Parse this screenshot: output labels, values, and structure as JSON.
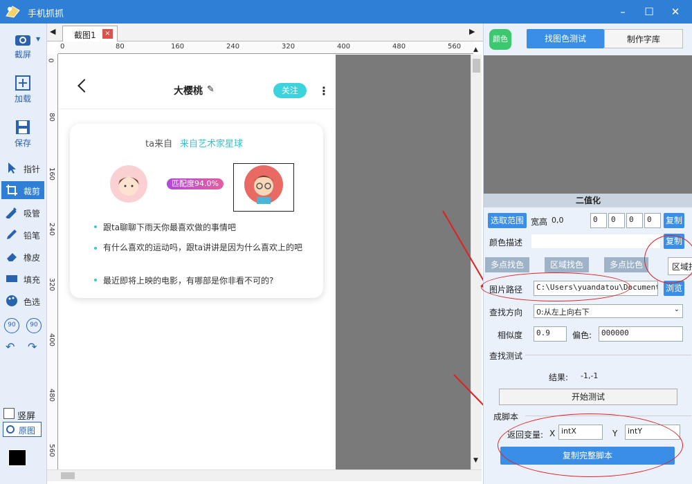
{
  "app": {
    "title": "手机抓抓"
  },
  "left_tools": {
    "screenshot": "截屏",
    "load": "加载",
    "save": "保存",
    "pointer": "指针",
    "crop": "裁剪",
    "pick": "吸管",
    "pencil": "铅笔",
    "eraser": "橡皮",
    "fill": "填充",
    "color": "色选",
    "rotl": "90",
    "rotr": "90",
    "portrait": "竖屏",
    "original": "原图"
  },
  "tab": {
    "label": "截图1",
    "close": "×"
  },
  "ruler_h": [
    "0",
    "80",
    "160",
    "240",
    "320",
    "400",
    "480",
    "560"
  ],
  "ruler_v": [
    "0",
    "80",
    "160",
    "240",
    "320",
    "400",
    "480",
    "560"
  ],
  "phone": {
    "name": "大樱桃",
    "follow": "关注",
    "from_prefix": "ta来自",
    "from_place": "来自艺术家星球",
    "match": "匹配度94.0%",
    "q1": "跟ta聊聊下雨天你最喜欢做的事情吧",
    "q2": "有什么喜欢的运动吗，跟ta讲讲是因为什么喜欢上的吧",
    "q3": "最近即将上映的电影，有哪部是你非看不可的?"
  },
  "right": {
    "color_btn": "颜色",
    "tab_test": "找图色测试",
    "tab_lib": "制作字库",
    "binarize": "二值化",
    "select_range": "选取范围",
    "wh_label": "宽高",
    "wh_value": "0,0",
    "r1": "0",
    "r2": "0",
    "r3": "0",
    "r4": "0",
    "copy1": "复制",
    "desc_label": "颜色描述",
    "copy2": "复制",
    "sub1": "多点找色",
    "sub2": "区域找色",
    "sub3": "多点比色",
    "sub4": "区域找图",
    "path_label": "图片路径",
    "path_value": "C:\\Users\\yuandatou\\Documents\\",
    "browse": "浏览",
    "dir_label": "查找方向",
    "dir_value": "0:从左上向右下",
    "sim_label": "相似度",
    "sim_value": "0.9",
    "bias_label": "偏色:",
    "bias_value": "000000",
    "test_label": "查找测试",
    "result_label": "结果:",
    "result_value": "-1,-1",
    "start_test": "开始测试",
    "script_label": "成脚本",
    "ret_label": "返回变量:",
    "x_label": "X",
    "x_value": "intX",
    "y_label": "Y",
    "y_value": "intY",
    "copy_script": "复制完整脚本"
  }
}
